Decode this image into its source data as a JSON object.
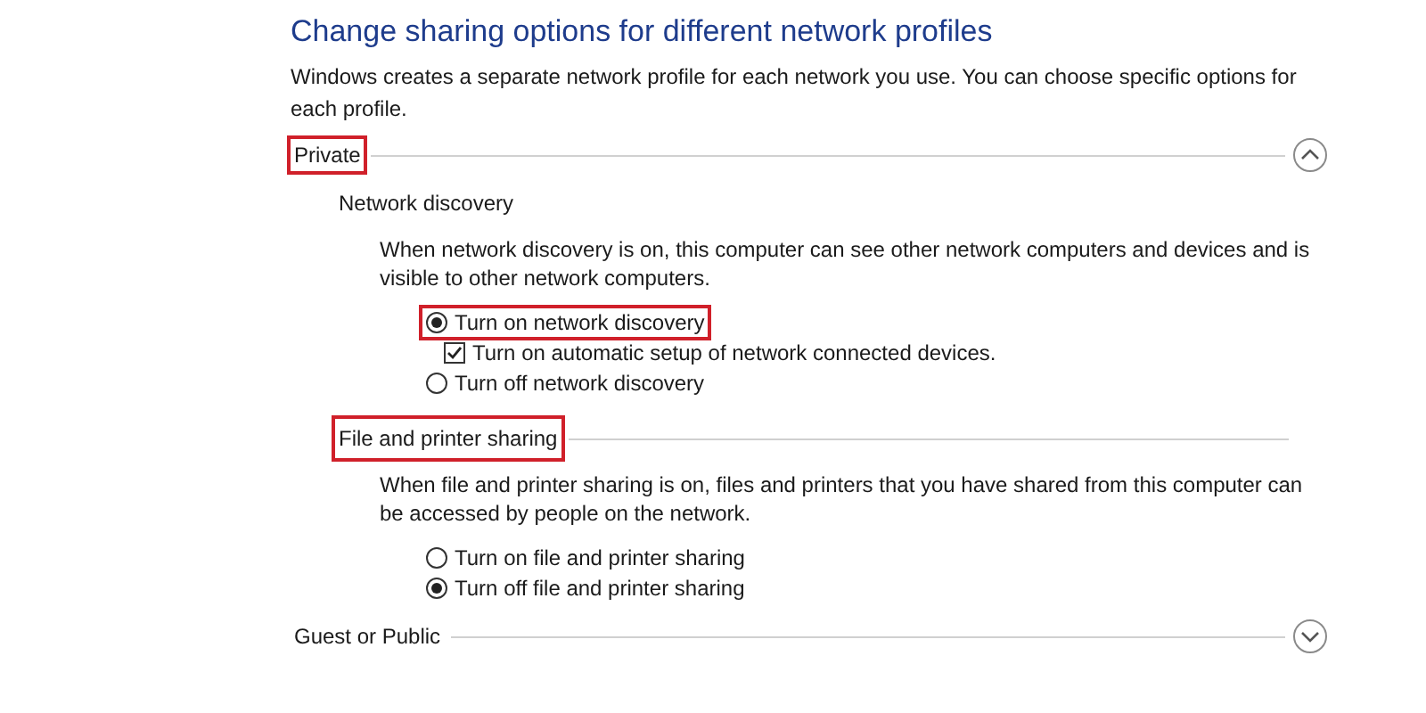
{
  "title": "Change sharing options for different network profiles",
  "description": "Windows creates a separate network profile for each network you use. You can choose specific options for each profile.",
  "profiles": [
    {
      "name": "Private",
      "expanded": true,
      "highlighted": true,
      "sections": [
        {
          "heading": "Network discovery",
          "highlighted": false,
          "description": "When network discovery is on, this computer can see other network computers and devices and is visible to other network computers.",
          "options": [
            {
              "kind": "radio",
              "label": "Turn on network discovery",
              "selected": true,
              "highlighted": true,
              "children": [
                {
                  "kind": "checkbox",
                  "label": "Turn on automatic setup of network connected devices.",
                  "checked": true
                }
              ]
            },
            {
              "kind": "radio",
              "label": "Turn off network discovery",
              "selected": false,
              "highlighted": false
            }
          ]
        },
        {
          "heading": "File and printer sharing",
          "highlighted": true,
          "description": "When file and printer sharing is on, files and printers that you have shared from this computer can be accessed by people on the network.",
          "options": [
            {
              "kind": "radio",
              "label": "Turn on file and printer sharing",
              "selected": false,
              "highlighted": false
            },
            {
              "kind": "radio",
              "label": "Turn off file and printer sharing",
              "selected": true,
              "highlighted": false
            }
          ]
        }
      ]
    },
    {
      "name": "Guest or Public",
      "expanded": false,
      "highlighted": false
    }
  ]
}
